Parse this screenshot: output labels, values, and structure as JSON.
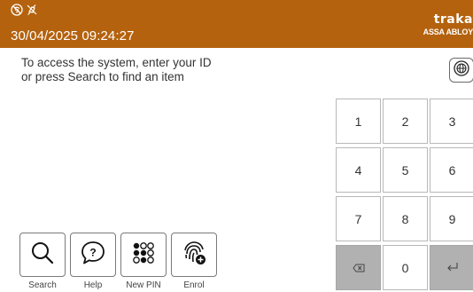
{
  "header": {
    "datetime": "30/04/2025 09:24:27",
    "logo_text": "traka",
    "logo_subtext": "ASSA ABLOY",
    "status_icons": [
      "network-off-icon",
      "power-off-icon"
    ],
    "background_color": "#b4620e"
  },
  "main": {
    "instruction_line1": "To access the system, enter your ID",
    "instruction_line2": "or press Search to find an item",
    "language_button_icon": "globe-icon"
  },
  "keypad": {
    "keys": [
      "1",
      "2",
      "3",
      "4",
      "5",
      "6",
      "7",
      "8",
      "9"
    ],
    "zero": "0",
    "backspace_icon": "backspace-icon",
    "enter_icon": "enter-icon"
  },
  "actions": [
    {
      "label": "Search",
      "icon": "search-icon"
    },
    {
      "label": "Help",
      "icon": "help-icon"
    },
    {
      "label": "New PIN",
      "icon": "pin-grid-icon"
    },
    {
      "label": "Enrol",
      "icon": "fingerprint-add-icon"
    }
  ]
}
